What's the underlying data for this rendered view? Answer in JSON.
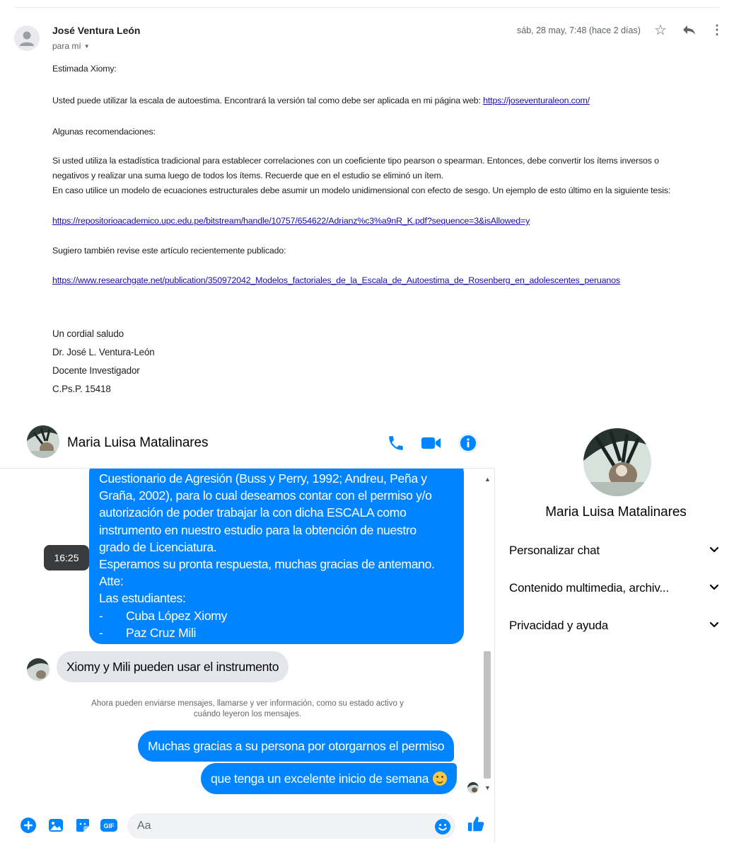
{
  "email": {
    "sender": "José Ventura León",
    "recipient": "para mí",
    "date": "sáb, 28 may, 7:48 (hace 2 días)",
    "body": {
      "greeting": "Estimada Xiomy:",
      "p1_text": "Usted puede utilizar la escala de autoestima. Encontrará la versión tal como debe ser aplicada en mi página web: ",
      "p1_link": "https://joseventuraleon.com/",
      "p2": "Algunas recomendaciones:",
      "p3_line1": "Si usted utiliza la estadística tradicional para establecer correlaciones con un coeficiente tipo pearson o spearman. Entonces, debe convertir los ítems inversos o",
      "p3_line2": "negativos y realizar una suma luego de todos los ítems. Recuerde que en el estudio se eliminó un ítem.",
      "p3_line3": "En caso utilice un modelo de ecuaciones estructurales debe asumir un modelo unidimensional con efecto de sesgo. Un ejemplo de esto último en la siguiente tesis:",
      "link2": "https://repositorioacademico.upc.edu.pe/bitstream/handle/10757/654622/Adrianz%c3%a9nR_K.pdf?sequence=3&isAllowed=y",
      "p4": "Sugiero también revise este artículo recientemente publicado:",
      "link3": "https://www.researchgate.net/publication/350972042_Modelos_factoriales_de_la_Escala_de_Autoestima_de_Rosenberg_en_adolescentes_peruanos"
    },
    "signature": [
      "Un cordial saludo",
      "Dr. José L. Ventura-León",
      "Docente Investigador",
      "C.Ps.P. 15418"
    ]
  },
  "messenger": {
    "contact_name": "Maria Luisa Matalinares",
    "timestamp_tooltip": "16:25",
    "sent_long_message": [
      "Cuestionario de Agresión (Buss y Perry, 1992; Andreu, Peña y",
      "Graña, 2002), para lo cual deseamos contar con el permiso y/o",
      "autorización de poder trabajar la con dicha ESCALA como",
      "instrumento en nuestro estudio para la obtención de nuestro",
      "grado de Licenciatura.",
      "Esperamos su pronta respuesta, muchas gracias de antemano.",
      "Atte:",
      "Las estudiantes:"
    ],
    "students": [
      "Cuba López Xiomy",
      "Paz Cruz Mili"
    ],
    "bullet": "-",
    "received_message": "Xiomy y Mili pueden usar el instrumento",
    "system_note_line1": "Ahora pueden enviarse mensajes, llamarse y ver información, como su estado activo y",
    "system_note_line2": "cuándo leyeron los mensajes.",
    "sent_message_1": "Muchas gracias a su persona por otorgarnos el permiso",
    "sent_message_2": "que tenga un excelente inicio de semana",
    "composer_placeholder": "Aa",
    "brand_color": "#0084ff"
  },
  "sidebar": {
    "name": "Maria Luisa Matalinares",
    "items": [
      {
        "label": "Personalizar chat"
      },
      {
        "label": "Contenido multimedia, archiv..."
      },
      {
        "label": "Privacidad y ayuda"
      }
    ]
  }
}
